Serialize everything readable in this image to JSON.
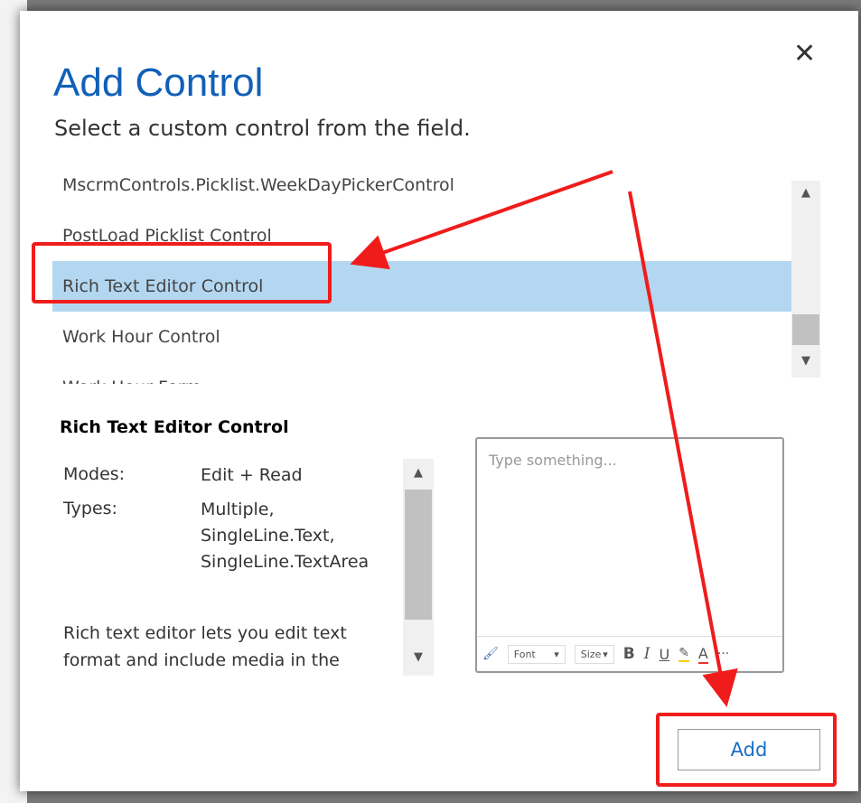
{
  "dialog": {
    "title": "Add Control",
    "subtitle": "Select a custom control from the field.",
    "close_label": "✕"
  },
  "list": {
    "items": [
      {
        "label": "MscrmControls.Picklist.WeekDayPickerControl",
        "selected": false
      },
      {
        "label": "PostLoad Picklist Control",
        "selected": false
      },
      {
        "label": "Rich Text Editor Control",
        "selected": true
      },
      {
        "label": "Work Hour Control",
        "selected": false
      },
      {
        "label": "Work Hour Form",
        "selected": false
      }
    ]
  },
  "details": {
    "title": "Rich Text Editor Control",
    "modes_label": "Modes:",
    "modes_value": "Edit + Read",
    "types_label": "Types:",
    "types_values": [
      "Multiple,",
      "SingleLine.Text,",
      "SingleLine.TextArea"
    ],
    "description": "Rich text editor lets you edit text format and include media in the text"
  },
  "preview": {
    "placeholder": "Type something...",
    "font_label": "Font",
    "size_label": "Size",
    "bold": "B",
    "italic": "I",
    "underline": "U",
    "font_color": "A",
    "more": "···"
  },
  "footer": {
    "add_label": "Add"
  },
  "colors": {
    "accent": "#1160b7",
    "selection": "#b3d7f0",
    "annotation": "#f01c1c"
  }
}
